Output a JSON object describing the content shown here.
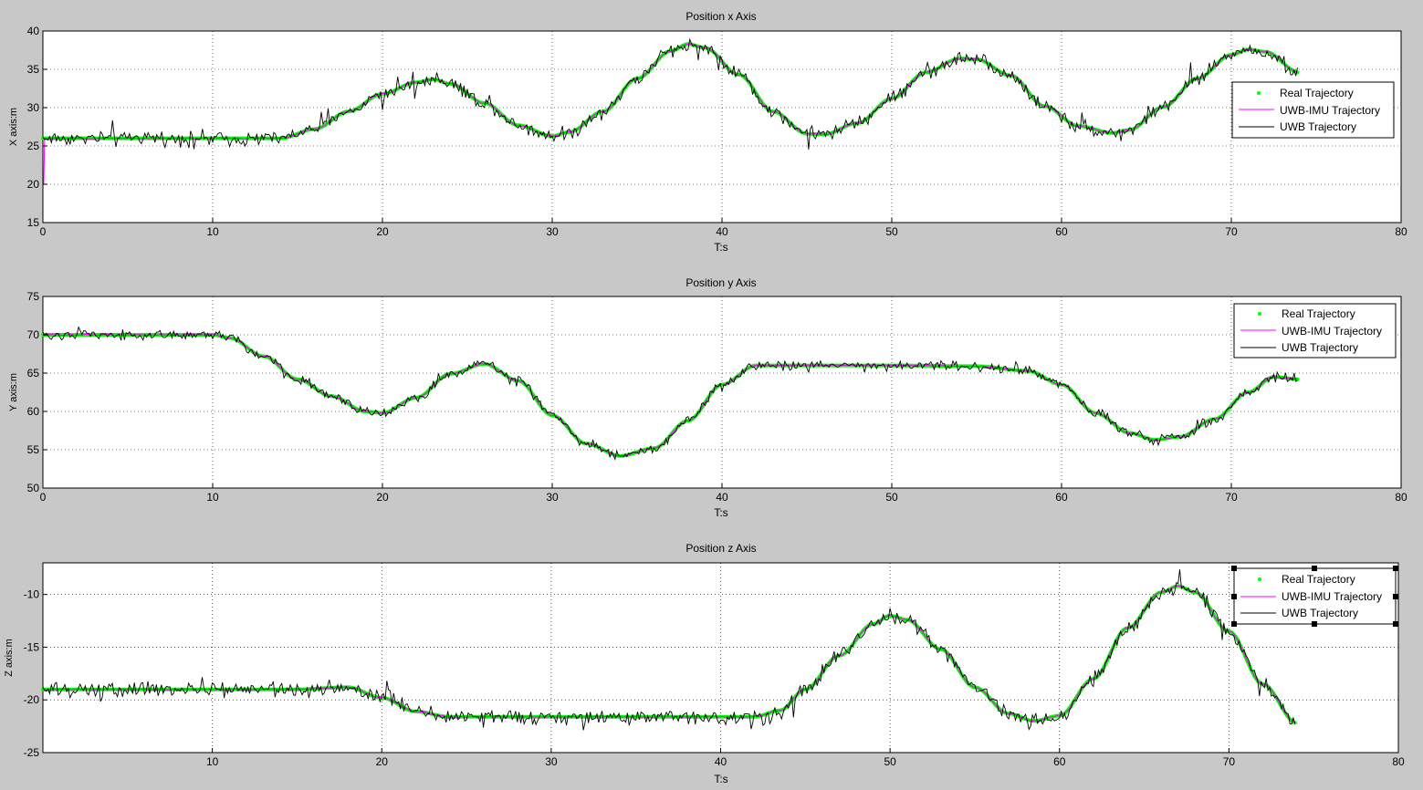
{
  "figure": {
    "background": "#c8c8c8"
  },
  "colors": {
    "real": "#00ff00",
    "uwb_imu": "#ff00ff",
    "uwb": "#000000",
    "axes_bg": "#ffffff",
    "grid": "#000000"
  },
  "chart_data": [
    {
      "type": "line",
      "title": "Position x Axis",
      "xlabel": "T:s",
      "ylabel": "X axis:m",
      "xlim": [
        0,
        80
      ],
      "ylim": [
        15,
        40
      ],
      "xticks": [
        0,
        10,
        20,
        30,
        40,
        50,
        60,
        70,
        80
      ],
      "yticks": [
        15,
        20,
        25,
        30,
        35,
        40
      ],
      "grid": true,
      "legend_position": "right",
      "series": [
        {
          "name": "Real Trajectory",
          "style": "points",
          "color": "#00ff00"
        },
        {
          "name": "UWB-IMU Trajectory",
          "style": "line",
          "color": "#ff00ff"
        },
        {
          "name": "UWB Trajectory",
          "style": "line",
          "color": "#000000"
        }
      ],
      "trajectory": {
        "x": [
          0,
          5,
          10,
          14,
          16,
          18,
          20,
          22,
          23,
          24,
          26,
          28,
          30,
          31,
          33,
          35,
          37,
          38,
          39,
          41,
          43,
          45,
          46,
          48,
          50,
          52,
          54,
          55,
          57,
          59,
          61,
          63,
          64,
          66,
          68,
          70,
          71,
          72,
          74
        ],
        "y": [
          26,
          26,
          26,
          26,
          27.2,
          29.5,
          31.8,
          33.3,
          33.7,
          33.1,
          30.6,
          27.7,
          26.3,
          26.8,
          29.5,
          33.8,
          37.4,
          38.3,
          37.8,
          34.3,
          29.5,
          26.6,
          26.5,
          28.0,
          31.2,
          34.6,
          36.4,
          36.3,
          34.2,
          30.2,
          27.6,
          26.7,
          27.1,
          30.1,
          33.8,
          36.9,
          37.6,
          37.3,
          34.6
        ]
      },
      "uwb_imu_initial_value": 20,
      "uwb_noise_amplitude": 0.9,
      "t_end": 74
    },
    {
      "type": "line",
      "title": "Position y Axis",
      "xlabel": "T:s",
      "ylabel": "Y axis:m",
      "xlim": [
        0,
        80
      ],
      "ylim": [
        50,
        75
      ],
      "xticks": [
        0,
        10,
        20,
        30,
        40,
        50,
        60,
        70,
        80
      ],
      "yticks": [
        50,
        55,
        60,
        65,
        70,
        75
      ],
      "grid": true,
      "legend_position": "top-right",
      "series": [
        {
          "name": "Real Trajectory",
          "style": "points",
          "color": "#00ff00"
        },
        {
          "name": "UWB-IMU Trajectory",
          "style": "line",
          "color": "#ff00ff"
        },
        {
          "name": "UWB Trajectory",
          "style": "line",
          "color": "#000000"
        }
      ],
      "trajectory": {
        "x": [
          0,
          5,
          10,
          11,
          13,
          15,
          17,
          19,
          20,
          22,
          24,
          26,
          28,
          30,
          32,
          34,
          36,
          38,
          40,
          42,
          45,
          50,
          55,
          58,
          60,
          62,
          64,
          65.5,
          67,
          69,
          71,
          72.5,
          74
        ],
        "y": [
          70,
          70,
          70,
          69.6,
          67.2,
          64.2,
          62.0,
          60.0,
          59.8,
          61.8,
          64.9,
          66.2,
          64.0,
          59.5,
          55.8,
          54.2,
          55.2,
          58.8,
          63.5,
          66.0,
          66.0,
          66.0,
          65.9,
          65.3,
          63.5,
          59.8,
          57.2,
          56.3,
          56.7,
          59.0,
          62.5,
          64.5,
          64.2
        ]
      },
      "uwb_noise_amplitude": 0.6,
      "t_end": 74
    },
    {
      "type": "line",
      "title": "Position z Axis",
      "xlabel": "T:s",
      "ylabel": "Z axis:m",
      "xlim": [
        0,
        80
      ],
      "ylim": [
        -25,
        -7
      ],
      "xticks": [
        10,
        20,
        30,
        40,
        50,
        60,
        70,
        80
      ],
      "yticks": [
        -25,
        -20,
        -15,
        -10
      ],
      "grid": true,
      "legend_position": "top-right",
      "legend_selected": true,
      "series": [
        {
          "name": "Real Trajectory",
          "style": "points",
          "color": "#00ff00"
        },
        {
          "name": "UWB-IMU Trajectory",
          "style": "line",
          "color": "#ff00ff"
        },
        {
          "name": "UWB Trajectory",
          "style": "line",
          "color": "#000000"
        }
      ],
      "trajectory": {
        "x": [
          0,
          5,
          10,
          15,
          18,
          20,
          22,
          24,
          26,
          30,
          35,
          40,
          42,
          43.5,
          45,
          47,
          49,
          50,
          51,
          53,
          55,
          57,
          58.5,
          60,
          62,
          64,
          66,
          67,
          68,
          70,
          72,
          74
        ],
        "y": [
          -19,
          -19,
          -19,
          -19,
          -18.8,
          -19.8,
          -21.1,
          -21.6,
          -21.6,
          -21.6,
          -21.6,
          -21.6,
          -21.6,
          -21.0,
          -19.0,
          -15.8,
          -12.8,
          -12.0,
          -12.4,
          -15.2,
          -18.8,
          -21.3,
          -22.0,
          -21.5,
          -18.0,
          -13.2,
          -9.8,
          -9.2,
          -9.8,
          -13.5,
          -18.5,
          -22.2
        ]
      },
      "uwb_noise_amplitude": 0.7,
      "t_end": 74
    }
  ]
}
